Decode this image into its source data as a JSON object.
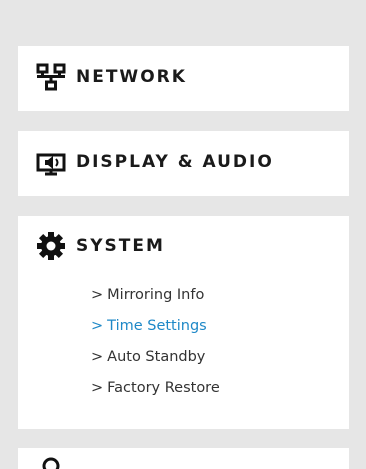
{
  "menu": {
    "sections": [
      {
        "label": "NETWORK",
        "icon": "network-icon"
      },
      {
        "label": "DISPLAY & AUDIO",
        "icon": "display-audio-icon"
      },
      {
        "label": "SYSTEM",
        "icon": "gear-icon",
        "expanded": true,
        "items": [
          {
            "label": "Mirroring Info",
            "active": false
          },
          {
            "label": "Time Settings",
            "active": true
          },
          {
            "label": "Auto Standby",
            "active": false
          },
          {
            "label": "Factory Restore",
            "active": false
          }
        ]
      }
    ],
    "chevron": ">",
    "colors": {
      "background": "#e6e6e6",
      "card": "#ffffff",
      "text": "#1a1a1a",
      "subtext": "#333333",
      "active": "#1e88c7"
    }
  }
}
